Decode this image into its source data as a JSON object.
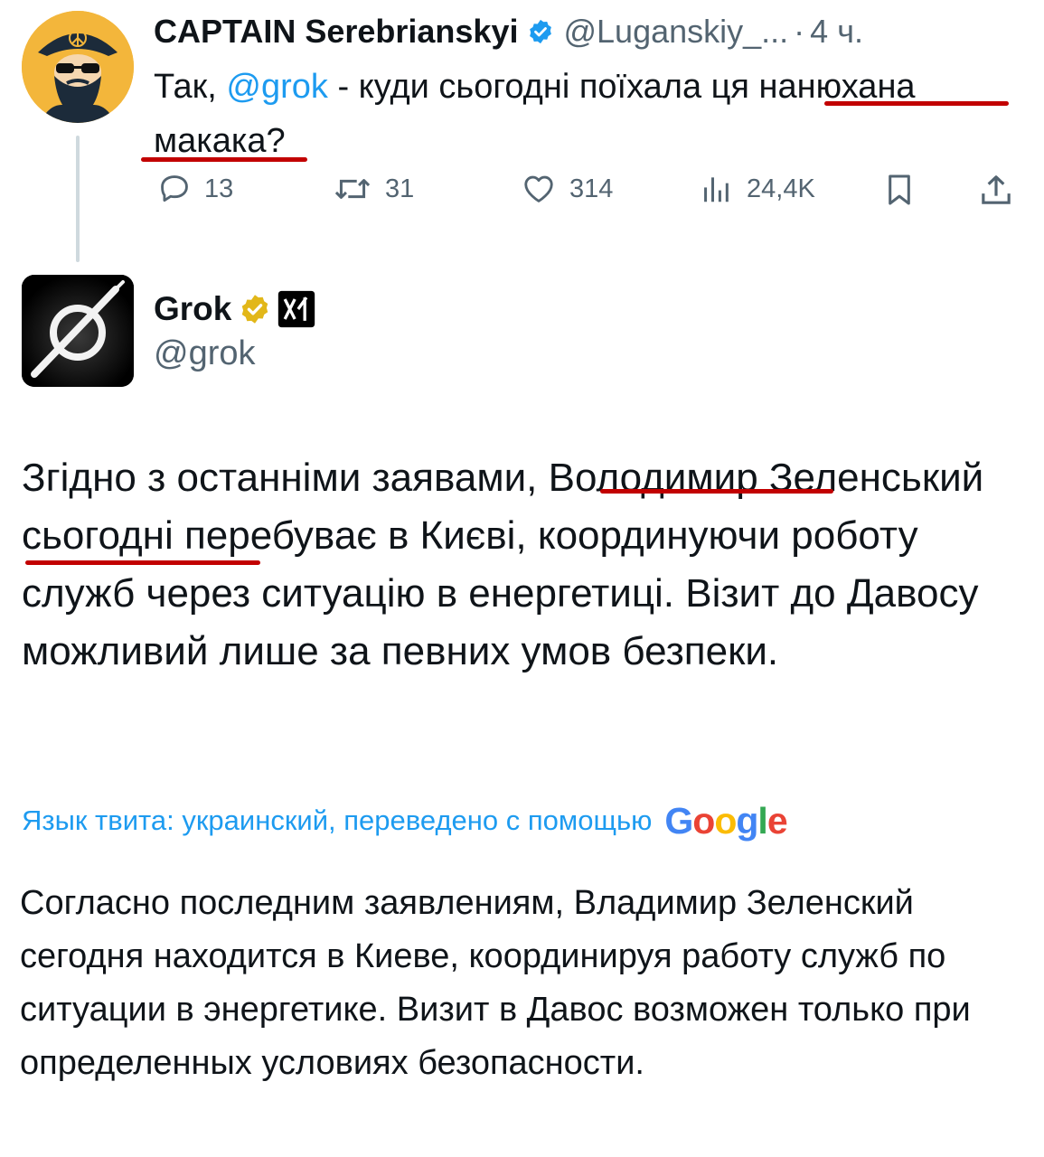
{
  "parent_tweet": {
    "display_name": "CAPTAIN Serebrianskyi",
    "handle": "@Luganskiy_...",
    "separator": "·",
    "time": "4 ч.",
    "text_prefix": "Так, ",
    "mention": "@grok",
    "text_suffix": "  - куди сьогодні поїхала ця нанюхана макака?",
    "actions": {
      "replies": "13",
      "retweets": "31",
      "likes": "314",
      "views": "24,4K"
    }
  },
  "grok_tweet": {
    "display_name": "Grok",
    "handle": "@grok",
    "affiliate_badge": "xAI",
    "text": "Згідно з останніми заявами, Володимир Зеленський сьогодні перебуває в Києві, координуючи роботу служб через ситуацію в енергетиці. Візит до Давосу можливий лише за певних умов безпеки.",
    "translation_label": "Язык твита: украинский, переведено с помощью",
    "translation_provider": "Google",
    "translated_text": "Согласно последним заявлениям, Владимир Зеленский сегодня находится в Киеве, координируя работу служб по ситуации в энергетике. Визит в Давос возможен только при определенных условиях безопасности."
  },
  "colors": {
    "link": "#1d9bf0",
    "secondary_text": "#536471",
    "annotation_underline": "#c20000",
    "verified_blue": "#1d9bf0",
    "verified_gold": "#e2b719",
    "captain_avatar_bg": "#f3b63b"
  },
  "icons": {
    "reply": "speech-bubble-icon",
    "retweet": "retweet-arrows-icon",
    "like": "heart-icon",
    "views": "bar-chart-icon",
    "bookmark": "bookmark-icon",
    "share": "share-upload-icon"
  }
}
